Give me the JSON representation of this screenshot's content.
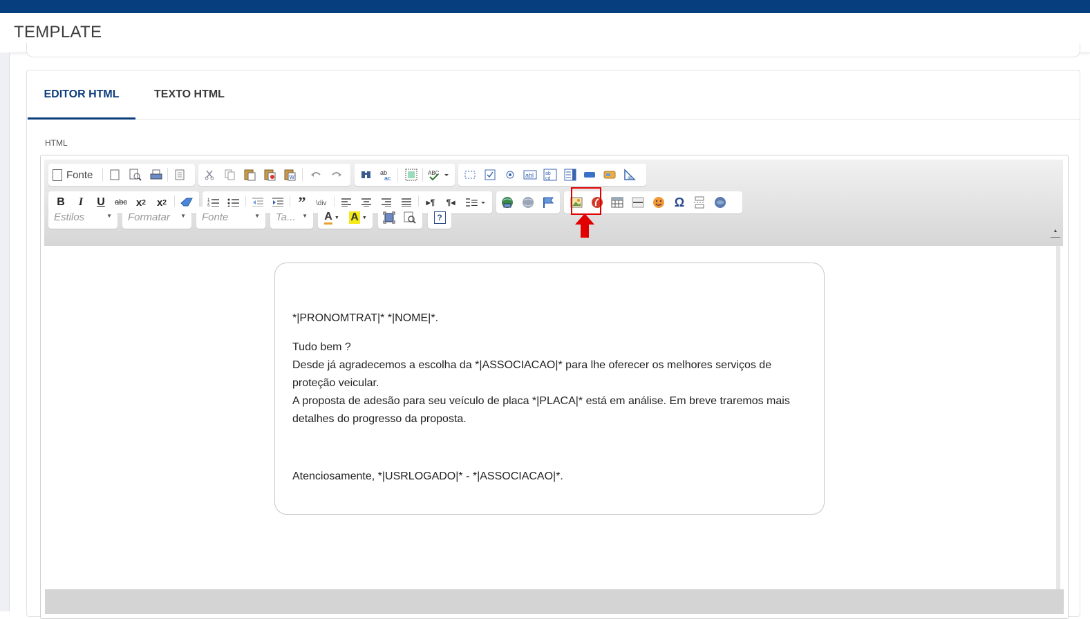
{
  "page": {
    "title": "TEMPLATE"
  },
  "tabs": [
    {
      "label": "EDITOR HTML",
      "active": true
    },
    {
      "label": "TEXTO HTML",
      "active": false
    }
  ],
  "field": {
    "label": "HTML"
  },
  "toolbar": {
    "source_label": "Fonte",
    "row1_icons": [
      "new-page-icon",
      "preview-icon",
      "print-icon",
      "templates-icon",
      "cut-icon",
      "copy-icon",
      "paste-icon",
      "paste-text-icon",
      "paste-word-icon",
      "undo-icon",
      "redo-icon",
      "find-icon",
      "replace-icon",
      "select-all-icon",
      "spellcheck-icon",
      "form-icon",
      "checkbox-icon",
      "radio-icon",
      "textfield-icon",
      "textarea-icon",
      "select-icon",
      "button-icon",
      "imagebutton-icon",
      "hiddenfield-icon"
    ],
    "row2_icons": [
      "bold-icon",
      "italic-icon",
      "underline-icon",
      "strike-icon",
      "subscript-icon",
      "superscript-icon",
      "remove-format-icon",
      "numbered-list-icon",
      "bulleted-list-icon",
      "outdent-icon",
      "indent-icon",
      "blockquote-icon",
      "div-icon",
      "align-left-icon",
      "align-center-icon",
      "align-right-icon",
      "justify-icon",
      "ltr-icon",
      "rtl-icon",
      "language-icon",
      "link-icon",
      "unlink-icon",
      "anchor-icon",
      "image-icon",
      "flash-icon",
      "table-icon",
      "horizontal-rule-icon",
      "smiley-icon",
      "special-char-icon",
      "page-break-icon",
      "iframe-icon"
    ],
    "styles_placeholder": "Estilos",
    "format_placeholder": "Formatar",
    "font_placeholder": "Fonte",
    "size_placeholder": "Ta...",
    "text_color_label": "A",
    "bg_color_label": "A",
    "help_label": "?"
  },
  "document": {
    "greeting": "*|PRONOMTRAT|* *|NOME|*.",
    "line1": "Tudo bem ?",
    "line2": "Desde já agradecemos a escolha da *|ASSOCIACAO|* para lhe oferecer os melhores serviços de proteção veicular.",
    "line3": "A proposta de adesão para seu veículo de placa *|PLACA|* está em análise. Em breve traremos mais detalhes do progresso da proposta.",
    "closing": "Atenciosamente, *|USRLOGADO|* - *|ASSOCIACAO|*."
  },
  "annotation": {
    "highlighted_button": "image-icon",
    "color": "#e00000"
  },
  "colors": {
    "brand": "#063e7e",
    "active_tab": "#0b3c7c"
  }
}
